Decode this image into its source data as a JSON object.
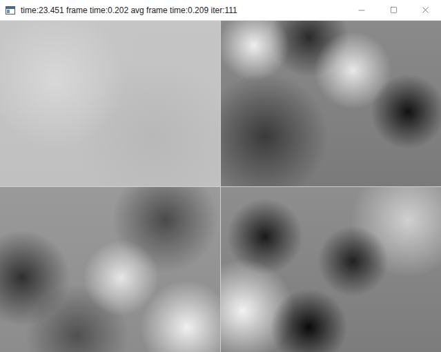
{
  "window": {
    "title": "time:23.451 frame time:0.202 avg frame time:0.209 iter:111"
  }
}
